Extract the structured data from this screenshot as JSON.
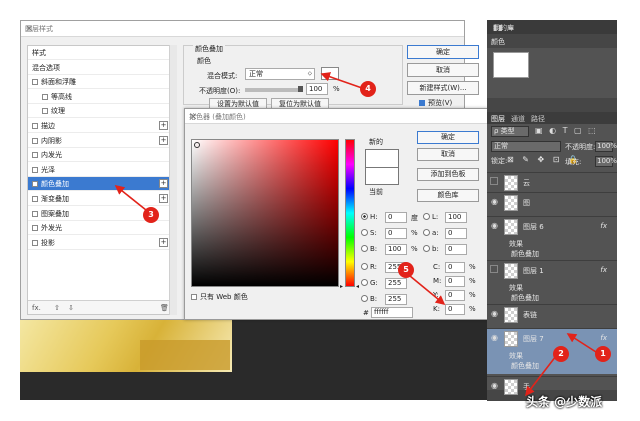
{
  "layer_style": {
    "title": "图层样式",
    "close": "✕",
    "list": [
      {
        "label": "样式",
        "checkbox": false,
        "plus": false,
        "indent": false
      },
      {
        "label": "混合选项",
        "checkbox": false,
        "plus": false,
        "indent": false
      },
      {
        "label": "斜面和浮雕",
        "checkbox": true,
        "plus": false,
        "indent": false
      },
      {
        "label": "等高线",
        "checkbox": true,
        "plus": false,
        "indent": true
      },
      {
        "label": "纹理",
        "checkbox": true,
        "plus": false,
        "indent": true
      },
      {
        "label": "描边",
        "checkbox": true,
        "plus": true,
        "indent": false
      },
      {
        "label": "内阴影",
        "checkbox": true,
        "plus": true,
        "indent": false
      },
      {
        "label": "内发光",
        "checkbox": true,
        "plus": false,
        "indent": false
      },
      {
        "label": "光泽",
        "checkbox": true,
        "plus": false,
        "indent": false
      },
      {
        "label": "颜色叠加",
        "checkbox": true,
        "plus": true,
        "indent": false,
        "selected": true
      },
      {
        "label": "渐变叠加",
        "checkbox": true,
        "plus": true,
        "indent": false
      },
      {
        "label": "图案叠加",
        "checkbox": true,
        "plus": false,
        "indent": false
      },
      {
        "label": "外发光",
        "checkbox": true,
        "plus": false,
        "indent": false
      },
      {
        "label": "投影",
        "checkbox": true,
        "plus": true,
        "indent": false
      }
    ],
    "footer_fx": "fx.",
    "footer_up": "⇧",
    "footer_down": "⇩",
    "footer_trash": "🗑",
    "section_title": "颜色叠加",
    "section_sub": "颜色",
    "blend_label": "混合模式:",
    "blend_value": "正常",
    "blend_arrow": "⬦",
    "opacity_label": "不透明度(O):",
    "opacity_value": "100",
    "opacity_unit": "%",
    "btn_default": "设置为默认值",
    "btn_reset": "复位为默认值",
    "ok": "确定",
    "cancel": "取消",
    "new_style": "新建样式(W)...",
    "preview": "预览(V)",
    "overlay_color": "#ffffff"
  },
  "color_picker": {
    "title": "拾色器 (叠加颜色)",
    "close": "✕",
    "new_label": "新的",
    "current_label": "当前",
    "ok": "确定",
    "cancel": "取消",
    "add_swatch": "添加到色板",
    "color_lib": "颜色库",
    "hsb": [
      {
        "label": "H:",
        "value": "0",
        "unit": "度",
        "on": true
      },
      {
        "label": "S:",
        "value": "0",
        "unit": "%",
        "on": false
      },
      {
        "label": "B:",
        "value": "100",
        "unit": "%",
        "on": false
      }
    ],
    "rgb": [
      {
        "label": "R:",
        "value": "255"
      },
      {
        "label": "G:",
        "value": "255"
      },
      {
        "label": "B:",
        "value": "255"
      }
    ],
    "lab": [
      {
        "label": "L:",
        "value": "100"
      },
      {
        "label": "a:",
        "value": "0"
      },
      {
        "label": "b:",
        "value": "0"
      }
    ],
    "cmyk": [
      {
        "label": "C:",
        "value": "0",
        "unit": "%"
      },
      {
        "label": "M:",
        "value": "0",
        "unit": "%"
      },
      {
        "label": "Y:",
        "value": "0",
        "unit": "%"
      },
      {
        "label": "K:",
        "value": "0",
        "unit": "%"
      }
    ],
    "web_only": "只有 Web 颜色",
    "hex_label": "#",
    "hex_value": "ffffff",
    "new_color": "#ffffff",
    "current_color": "#ffffff"
  },
  "layers_panel": {
    "top_title": "我的库",
    "top_icons": "▮▮ ≡",
    "color_tab": "颜色",
    "tabs": [
      "图层",
      "通道",
      "路径"
    ],
    "filter_label": "ρ 类型",
    "filter_icons": "▣ ◐ T ▢ ⬚",
    "mode": "正常",
    "opacity_label": "不透明度:",
    "opacity_value": "100%",
    "lock_label": "锁定:",
    "lock_icons": "⊠ ✎ ✥ ⊡ 🔒",
    "fill_label": "填充:",
    "fill_value": "100%",
    "layers": [
      {
        "name": "云",
        "visible": false,
        "fx": ""
      },
      {
        "name": "图",
        "visible": true,
        "fx": ""
      },
      {
        "name": "图层 6",
        "visible": true,
        "fx": "fx"
      },
      {
        "name": "图层 1",
        "visible": false,
        "fx": "fx"
      },
      {
        "name": "表链",
        "visible": true,
        "fx": ""
      },
      {
        "name": "图层 7",
        "visible": true,
        "fx": "fx",
        "selected": true
      },
      {
        "name": "手",
        "visible": true,
        "fx": ""
      }
    ],
    "effects_label": "效果",
    "overlay_effect": "颜色叠加"
  },
  "annotations": [
    "1",
    "2",
    "3",
    "4",
    "5"
  ],
  "watermark": "头条 @少数派",
  "colors": {
    "accent": "#3b7ad0",
    "marker": "#e2231a",
    "panel": "#535353"
  }
}
